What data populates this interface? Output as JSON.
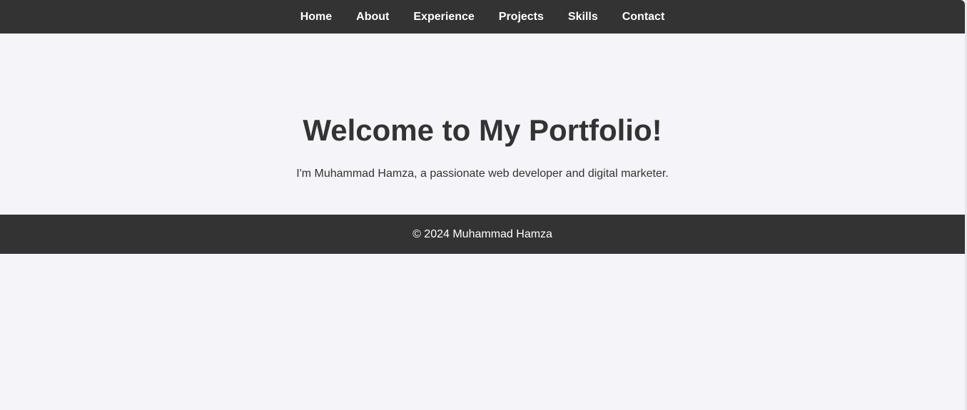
{
  "nav": {
    "items": [
      {
        "label": "Home"
      },
      {
        "label": "About"
      },
      {
        "label": "Experience"
      },
      {
        "label": "Projects"
      },
      {
        "label": "Skills"
      },
      {
        "label": "Contact"
      }
    ]
  },
  "hero": {
    "title": "Welcome to My Portfolio!",
    "subtitle": "I'm Muhammad Hamza, a passionate web developer and digital marketer."
  },
  "footer": {
    "text": "© 2024 Muhammad Hamza"
  },
  "colors": {
    "bar_background": "#333333",
    "page_background": "#f4f4f9",
    "nav_text": "#ffffff",
    "body_text": "#333333"
  }
}
